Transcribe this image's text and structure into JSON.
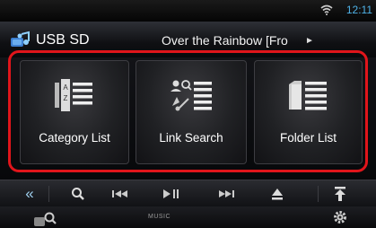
{
  "status": {
    "time": "12:11",
    "wifi_icon": "wifi-icon"
  },
  "header": {
    "source": "USB SD",
    "track": "Over the Rainbow [Fro",
    "next_indicator": "►",
    "source_icon": "usb-music-icon"
  },
  "menu": {
    "highlight_color": "#e0151b",
    "items": [
      {
        "label": "Category List",
        "icon": "category-list-icon"
      },
      {
        "label": "Link Search",
        "icon": "link-search-icon"
      },
      {
        "label": "Folder List",
        "icon": "folder-list-icon"
      }
    ]
  },
  "controls": {
    "collapse": "«",
    "search_icon": "search-icon",
    "prev_icon": "skip-previous-icon",
    "play_pause_icon": "play-pause-icon",
    "next_icon": "skip-next-icon",
    "eject_icon": "eject-icon",
    "up_icon": "arrow-up-icon"
  },
  "bottom": {
    "mode": "MUSIC",
    "left_icon": "search-person-icon",
    "settings_icon": "gear-icon"
  },
  "colors": {
    "accent": "#4fb3e8",
    "background": "#000000"
  }
}
